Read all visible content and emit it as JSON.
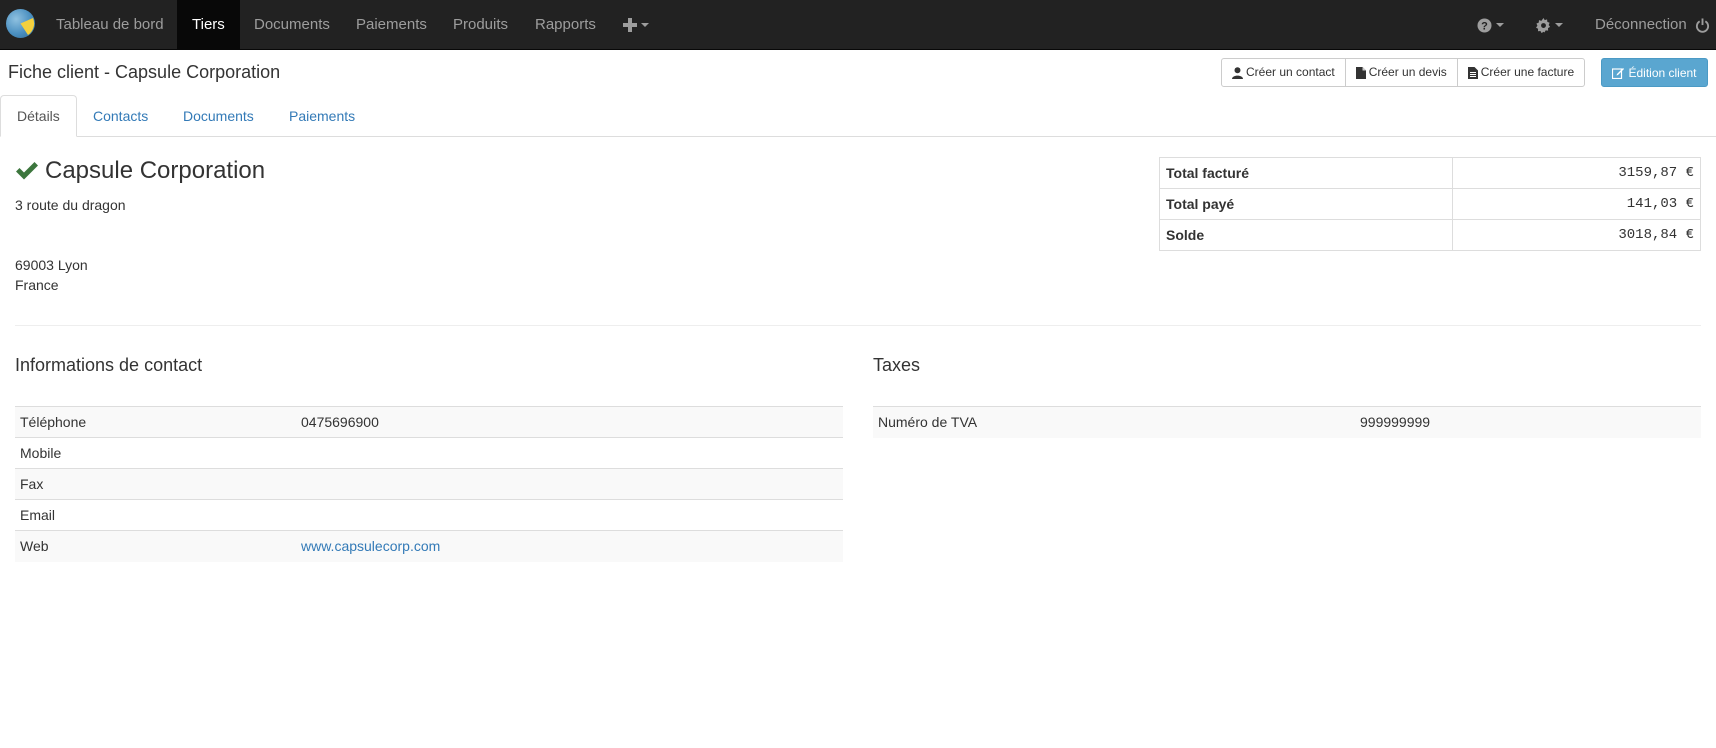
{
  "navbar": {
    "items": [
      {
        "label": "Tableau de bord"
      },
      {
        "label": "Tiers"
      },
      {
        "label": "Documents"
      },
      {
        "label": "Paiements"
      },
      {
        "label": "Produits"
      },
      {
        "label": "Rapports"
      }
    ],
    "logout_label": "Déconnection",
    "icons": [
      "plus-icon",
      "help-icon",
      "gear-icon",
      "power-icon"
    ]
  },
  "header": {
    "title": "Fiche client - Capsule Corporation",
    "buttons": {
      "create_contact": "Créer un contact",
      "create_quote": "Créer un devis",
      "create_invoice": "Créer une facture",
      "edit_client": "Édition client"
    }
  },
  "tabs": [
    {
      "label": "Détails"
    },
    {
      "label": "Contacts"
    },
    {
      "label": "Documents"
    },
    {
      "label": "Paiements"
    }
  ],
  "client": {
    "name": "Capsule Corporation",
    "address_line1": "3 route du dragon",
    "city_line": "69003 Lyon",
    "country": "France"
  },
  "totals": [
    {
      "label": "Total facturé",
      "value": "3159,87 €"
    },
    {
      "label": "Total payé",
      "value": "141,03 €"
    },
    {
      "label": "Solde",
      "value": "3018,84 €"
    }
  ],
  "contact_info": {
    "title": "Informations de contact",
    "rows": [
      {
        "label": "Téléphone",
        "value": "0475696900"
      },
      {
        "label": "Mobile",
        "value": ""
      },
      {
        "label": "Fax",
        "value": ""
      },
      {
        "label": "Email",
        "value": ""
      },
      {
        "label": "Web",
        "value": "www.capsulecorp.com"
      }
    ]
  },
  "taxes": {
    "title": "Taxes",
    "rows": [
      {
        "label": "Numéro de TVA",
        "value": "999999999"
      }
    ]
  },
  "colors": {
    "navbar_bg": "#222222",
    "link": "#337ab7",
    "primary_button": "#5aa6d0",
    "check_green": "#3c763d"
  }
}
